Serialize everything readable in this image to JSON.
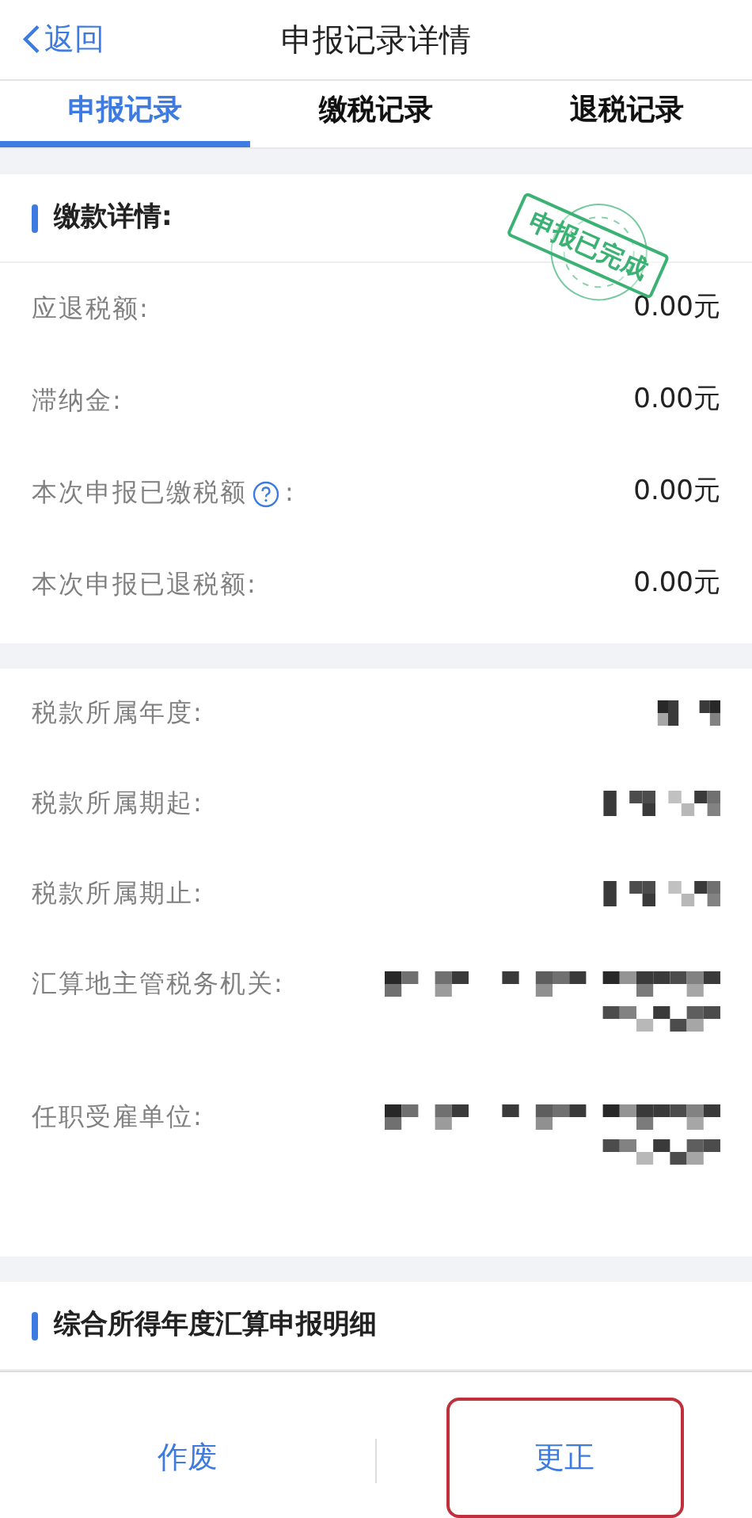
{
  "header": {
    "back": "返回",
    "title": "申报记录详情"
  },
  "tabs": [
    {
      "label": "申报记录",
      "selected": true
    },
    {
      "label": "缴税记录",
      "selected": false
    },
    {
      "label": "退税记录",
      "selected": false
    }
  ],
  "payment": {
    "title": "缴款详情:",
    "stamp": "申报已完成",
    "rows": [
      {
        "label": "应退税额:",
        "value": "0.00元",
        "kind": "amount",
        "help": false
      },
      {
        "label": "滞纳金:",
        "value": "0.00元",
        "kind": "amount",
        "help": false
      },
      {
        "label": "本次申报已缴税额",
        "suffix": ":",
        "value": "0.00元",
        "kind": "amount",
        "help": true
      },
      {
        "label": "本次申报已退税额:",
        "value": "0.00元",
        "kind": "amount",
        "help": false
      }
    ]
  },
  "info": {
    "rows": [
      {
        "label": "税款所属年度:",
        "kind": "redacted-short"
      },
      {
        "label": "税款所属期起:",
        "kind": "redacted-medium"
      },
      {
        "label": "税款所属期止:",
        "kind": "redacted-medium"
      },
      {
        "label": "汇算地主管税务机关:",
        "kind": "redacted-long"
      },
      {
        "label": "任职受雇单位:",
        "kind": "redacted-long"
      }
    ]
  },
  "detail": {
    "title": "综合所得年度汇算申报明细"
  },
  "buttons": [
    {
      "label": "作废",
      "highlighted": false
    },
    {
      "label": "更正",
      "highlighted": true
    }
  ]
}
